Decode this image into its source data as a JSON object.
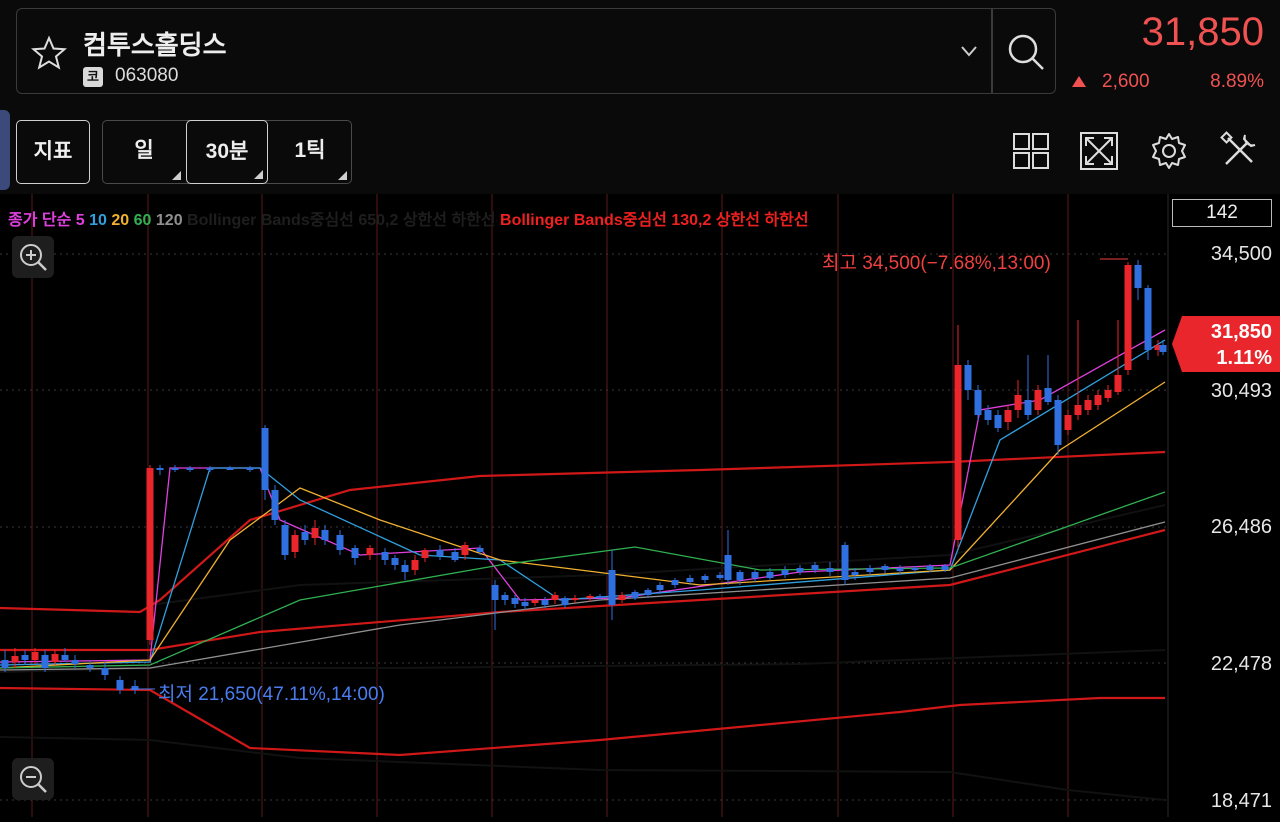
{
  "header": {
    "stock_name": "컴투스홀딩스",
    "market_badge": "코",
    "stock_code": "063080",
    "price": "31,850",
    "change_value": "2,600",
    "change_percent": "8.89%"
  },
  "toolbar": {
    "indicator_label": "지표",
    "periods": [
      "일",
      "30분",
      "1틱"
    ],
    "selected_period": "30분"
  },
  "legend": {
    "prefix": "종가 단순",
    "ma": [
      "5",
      "10",
      "20",
      "60",
      "120"
    ],
    "bb1": "Bollinger Bands중심선 650,2 상한선 하한선",
    "bb2": "Bollinger Bands중심선 130,2 상한선 하한선"
  },
  "chart": {
    "count_box": "142",
    "y_labels": [
      "34,500",
      "30,493",
      "26,486",
      "22,478",
      "18,471"
    ],
    "current_price": "31,850",
    "current_rate": "1.11%",
    "high_annotation": "최고 34,500(−7.68%,13:00)",
    "low_annotation": "최저 21,650(47.11%,14:00)"
  },
  "colors": {
    "up": "#e8262b",
    "down": "#2f6fe0",
    "ma5": "#e040e0",
    "ma10": "#30a0e0",
    "ma20": "#f0b030",
    "ma60": "#30b050",
    "ma120": "#909090"
  },
  "icons": [
    "star-icon",
    "chevron-down-icon",
    "search-icon",
    "layout-grid-icon",
    "fullscreen-icon",
    "settings-icon",
    "tools-icon",
    "zoom-in-icon",
    "zoom-out-icon"
  ]
}
